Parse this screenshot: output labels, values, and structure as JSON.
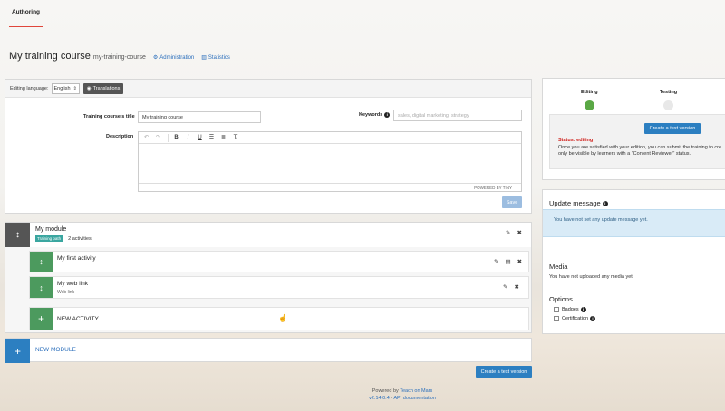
{
  "nav": {
    "tab_authoring": "Authoring"
  },
  "course": {
    "title": "My training course",
    "slug": "my-training-course",
    "link_administration": "Administration",
    "link_statistics": "Statistics"
  },
  "editor": {
    "editing_language_label": "Editing language:",
    "language_value": "English",
    "translations_button": "Translations",
    "title_label": "Training course's title",
    "title_value": "My training course",
    "keywords_label": "Keywords",
    "keywords_placeholder": "sales, digital marketing, strategy",
    "description_label": "Description",
    "powered_by_tiny": "POWERED BY TINY",
    "save_button": "Save"
  },
  "module": {
    "title": "My module",
    "badge": "Training path",
    "activities_count": "2 activities",
    "activities": [
      {
        "title": "My first activity",
        "subtitle": ""
      },
      {
        "title": "My web link",
        "subtitle": "Web link"
      }
    ],
    "new_activity": "NEW ACTIVITY"
  },
  "new_module": "NEW MODULE",
  "create_test_version_button": "Create a test version",
  "footer": {
    "powered_by": "Powered by",
    "brand": "Teach on Mars",
    "version": "v2.14.0.4",
    "separator": "-",
    "api_docs": "API documentation"
  },
  "status": {
    "editing_label": "Editing",
    "testing_label": "Testing",
    "create_test_button": "Create a test version",
    "status_title": "Status: editing",
    "status_line1": "Once you are satisfied with your edition, you can submit the training to cre",
    "status_line2": "only be visible by learners with a \"Content Reviewer\" status.",
    "editing_color": "#5aa845",
    "testing_color": "#e8e8e8"
  },
  "side": {
    "update_message_heading": "Update message",
    "update_message_text": "You have not set any update message yet.",
    "media_heading": "Media",
    "media_text": "You have not uploaded any media yet.",
    "options_heading": "Options",
    "option_badges": "Badges",
    "option_certification": "Certification"
  }
}
